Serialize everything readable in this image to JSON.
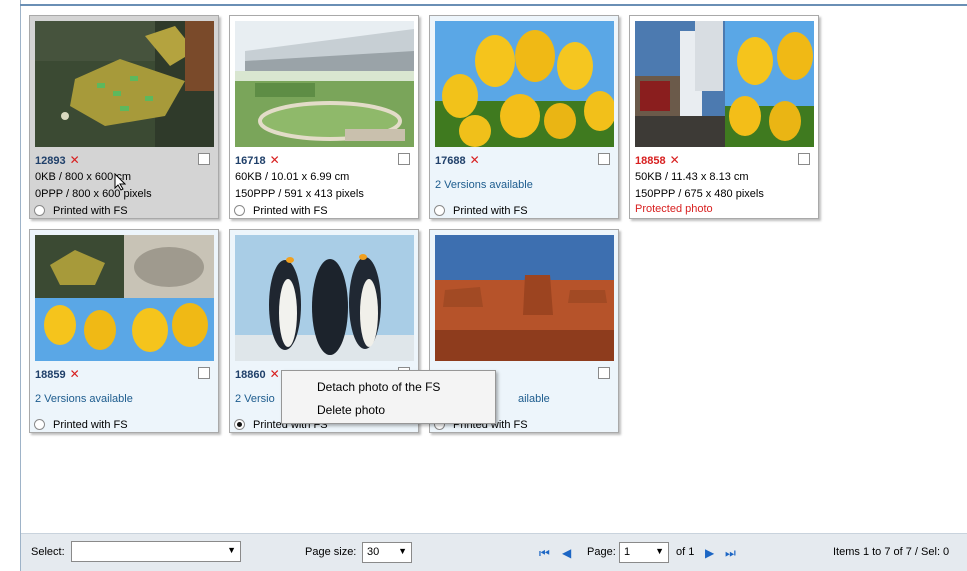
{
  "cards": [
    {
      "id": "12893",
      "line2": "0KB / 800 x 600 cm",
      "line3": "0PPP / 800 x 600 pixels",
      "radio_label": "Printed with FS"
    },
    {
      "id": "16718",
      "line2": "60KB / 10.01 x 6.99 cm",
      "line3": "150PPP / 591 x 413 pixels",
      "radio_label": "Printed with FS"
    },
    {
      "id": "17688",
      "versions": "2 Versions available",
      "radio_label": "Printed with FS"
    },
    {
      "id": "18858",
      "line2": "50KB / 11.43 x 8.13 cm",
      "line3": "150PPP / 675 x 480 pixels",
      "protected": "Protected photo"
    },
    {
      "id": "18859",
      "versions": "2 Versions available",
      "radio_label": "Printed with FS"
    },
    {
      "id": "18860",
      "versions_partial": "2 Versio",
      "radio_label": "Printed with FS"
    },
    {
      "versions_partial": "ailable",
      "radio_label": "Printed with FS"
    }
  ],
  "context_menu": {
    "items": [
      "Detach photo of the FS",
      "Delete photo"
    ]
  },
  "footer": {
    "select_label": "Select:",
    "select_value": "",
    "page_size_label": "Page size:",
    "page_size_value": "30",
    "page_label": "Page:",
    "page_value": "1",
    "page_of": "of 1",
    "items_info": "Items 1 to 7 of 7 / Sel: 0"
  },
  "icons": {
    "remove": "x-icon",
    "first": "first-page-icon",
    "prev": "prev-page-icon",
    "next": "next-page-icon",
    "last": "last-page-icon",
    "dropdown": "chevron-down-icon"
  },
  "colors": {
    "id_text": "#20406a",
    "remove_x": "#d82020",
    "protected": "#d82020",
    "versions_link": "#1d5c8e",
    "card_bg": "#edf5fb",
    "selected_card_bg": "#d4d4d4",
    "footer_bg": "#e5eaef"
  }
}
